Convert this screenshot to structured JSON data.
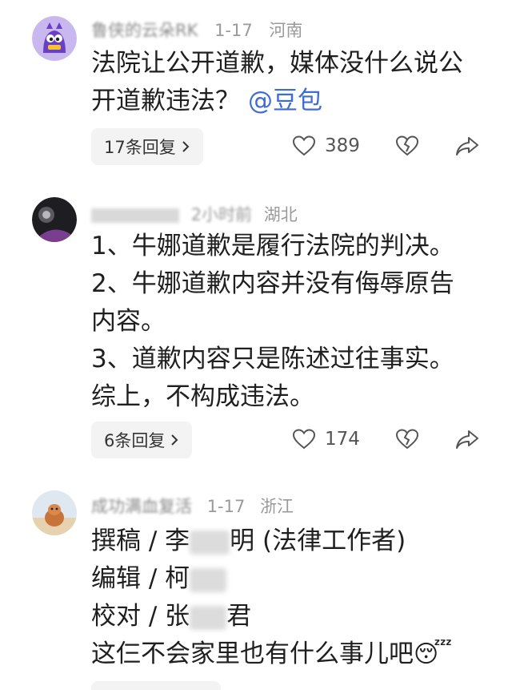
{
  "comments": [
    {
      "name": "鲁侠的云朵RK",
      "date": "1-17",
      "location": "河南",
      "lines": [
        "法院让公开道歉，媒体没什么说公",
        "开道歉违法？"
      ],
      "mention": "@豆包",
      "reply_label": "17条回复",
      "likes": "389"
    },
    {
      "name": "",
      "date": "2小时前",
      "location": "湖北",
      "lines": [
        "1、牛娜道歉是履行法院的判决。",
        "2、牛娜道歉内容并没有侮辱原告",
        "内容。",
        "3、道歉内容只是陈述过往事实。",
        "综上，不构成违法。"
      ],
      "reply_label": "6条回复",
      "likes": "174"
    },
    {
      "name": "成功满血复活",
      "date": "1-17",
      "location": "浙江",
      "credits": [
        {
          "role": "撰稿 / 李",
          "tail": "明 (法律工作者)"
        },
        {
          "role": "编辑 / 柯",
          "tail": ""
        },
        {
          "role": "校对 / 张",
          "tail": "君"
        }
      ],
      "last_line": "这仨不会家里也有什么事儿吧",
      "emoji": "😴"
    }
  ],
  "icons": {
    "reply_chevron": "chevron-right-icon",
    "like": "heart-icon",
    "dislike": "broken-heart-icon",
    "share": "share-icon"
  }
}
